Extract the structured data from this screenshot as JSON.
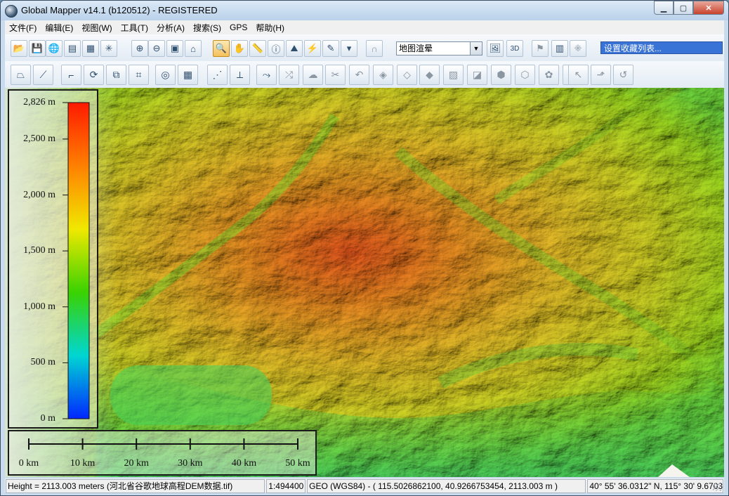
{
  "window": {
    "title": "Global Mapper v14.1 (b120512) - REGISTERED",
    "minimize": "0",
    "maximize": "1",
    "close": "r"
  },
  "menu": [
    "文件(F)",
    "编辑(E)",
    "视图(W)",
    "工具(T)",
    "分析(A)",
    "搜索(S)",
    "GPS",
    "帮助(H)"
  ],
  "toolbar1": {
    "buttons": [
      {
        "name": "open-file-icon",
        "glyph": "📂"
      },
      {
        "name": "save-icon",
        "glyph": "💾"
      },
      {
        "name": "globe-icon",
        "glyph": "🌐"
      },
      {
        "name": "catalog-icon",
        "glyph": "▤"
      },
      {
        "name": "overlay-control-icon",
        "glyph": "▦"
      },
      {
        "name": "config-icon",
        "glyph": "✳"
      },
      {
        "name": "zoom-in-icon",
        "glyph": "⊕"
      },
      {
        "name": "zoom-out-icon",
        "glyph": "⊖"
      },
      {
        "name": "full-view-icon",
        "glyph": "▣"
      },
      {
        "name": "home-view-icon",
        "glyph": "⌂"
      },
      {
        "name": "zoom-tool-icon",
        "glyph": "🔍"
      },
      {
        "name": "pan-tool-icon",
        "glyph": "✋"
      },
      {
        "name": "measure-tool-icon",
        "glyph": "📏"
      },
      {
        "name": "feature-info-icon",
        "glyph": "ⓘ"
      },
      {
        "name": "path-profile-icon",
        "glyph": "⛰"
      },
      {
        "name": "tower-icon",
        "glyph": "⚡"
      },
      {
        "name": "digitizer-icon",
        "glyph": "✎"
      },
      {
        "name": "dropdown-tool-icon",
        "glyph": "▾"
      },
      {
        "name": "gps-icon",
        "glyph": "∩"
      },
      {
        "name": "3d-path-icon",
        "glyph": "🖼"
      },
      {
        "name": "3d-view-icon",
        "glyph": "3D"
      },
      {
        "name": "flag-icon",
        "glyph": "⚑"
      },
      {
        "name": "layer-window-icon",
        "glyph": "▥"
      },
      {
        "name": "link-icon",
        "glyph": "⁜"
      }
    ],
    "shader_select": "地图渲晕",
    "favorites_box": "设置收藏列表..."
  },
  "toolbar2": {
    "buttons": [
      {
        "name": "create-area-icon",
        "glyph": "⏢"
      },
      {
        "name": "create-line-icon",
        "glyph": "⟋"
      },
      {
        "name": "create-point-icon",
        "glyph": "⌐"
      },
      {
        "name": "rotate-feature-icon",
        "glyph": "⟳"
      },
      {
        "name": "edit-vertices-icon",
        "glyph": "⧉"
      },
      {
        "name": "attribute-code-icon",
        "glyph": "⌗"
      },
      {
        "name": "combine-areas-icon",
        "glyph": "◎"
      },
      {
        "name": "grid-create-icon",
        "glyph": "▦"
      },
      {
        "name": "move-vertex-icon",
        "glyph": "⋰"
      },
      {
        "name": "insert-vertex-icon",
        "glyph": "⟂"
      },
      {
        "name": "split-line-icon",
        "glyph": "⤳"
      },
      {
        "name": "join-lines-icon",
        "glyph": "⤮"
      },
      {
        "name": "smooth-area-icon",
        "glyph": "☁"
      },
      {
        "name": "cut-line-icon",
        "glyph": "✂"
      },
      {
        "name": "undo-shape-icon",
        "glyph": "↶"
      },
      {
        "name": "buffer-icon",
        "glyph": "◈"
      },
      {
        "name": "union-icon",
        "glyph": "◇"
      },
      {
        "name": "intersect-icon",
        "glyph": "◆"
      },
      {
        "name": "crop-icon",
        "glyph": "▨"
      },
      {
        "name": "split-area-icon",
        "glyph": "◪"
      },
      {
        "name": "area-merge-icon",
        "glyph": "⬢"
      },
      {
        "name": "area-subtract-icon",
        "glyph": "⬡"
      },
      {
        "name": "area-simplify-icon",
        "glyph": "✿"
      },
      {
        "name": "area-rotate-icon",
        "glyph": "⟲"
      },
      {
        "name": "arrow-select-icon",
        "glyph": "↖"
      },
      {
        "name": "step-forward-icon",
        "glyph": "⬏"
      },
      {
        "name": "curve-back-icon",
        "glyph": "↺"
      }
    ]
  },
  "legend": {
    "labels": [
      "2,826 m",
      "2,500 m",
      "2,000 m",
      "1,500 m",
      "1,000 m",
      "500 m",
      "0 m"
    ],
    "values": [
      2826,
      2500,
      2000,
      1500,
      1000,
      500,
      0
    ],
    "max": 2826
  },
  "scalebar": {
    "labels": [
      "0 km",
      "10 km",
      "20 km",
      "30 km",
      "40 km",
      "50 km"
    ]
  },
  "status": {
    "info": "Height = 2113.003 meters (河北省谷歌地球高程DEM数据.tif)",
    "scale": "1:494400",
    "coords": "GEO (WGS84) - ( 115.5026862100, 40.9266753454, 2113.003 m )",
    "dms": "40° 55' 36.0312\" N, 115° 30' 9.6703\" E"
  },
  "colors": {
    "accent": "#3873d5",
    "title_bar": "#c9dcee",
    "ramp_top": "#ff1a00",
    "ramp_bottom": "#0026ff"
  }
}
